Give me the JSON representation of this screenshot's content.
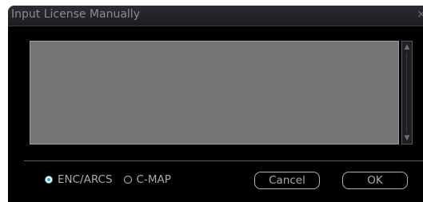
{
  "dialog": {
    "title": "Input License Manually",
    "close_glyph": "×"
  },
  "license_input": {
    "value": ""
  },
  "scrollbar": {
    "up_glyph": "▲",
    "down_glyph": "▼"
  },
  "source_options": [
    {
      "label": "ENC/ARCS",
      "selected": true
    },
    {
      "label": "C-MAP",
      "selected": false
    }
  ],
  "buttons": {
    "cancel_label": "Cancel",
    "ok_label": "OK"
  },
  "colors": {
    "accent": "#3ca7c8",
    "text_area": "#757578",
    "background": "#000000"
  }
}
